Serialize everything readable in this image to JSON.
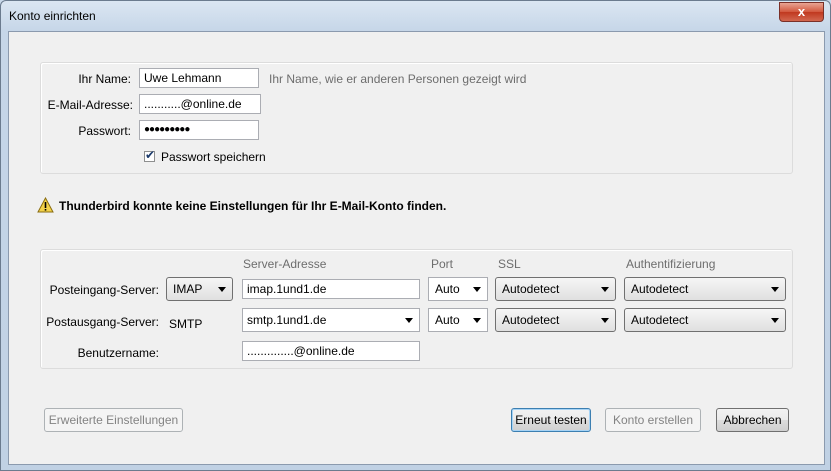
{
  "window": {
    "title": "Konto einrichten",
    "close_label": "x"
  },
  "identity": {
    "name_label": "Ihr Name:",
    "name_value": "Uwe Lehmann",
    "name_hint": "Ihr Name, wie er anderen Personen gezeigt wird",
    "email_label": "E-Mail-Adresse:",
    "email_value": "...........@online.de",
    "password_label": "Passwort:",
    "password_value": "●●●●●●●●●",
    "remember_label": "Passwort speichern",
    "remember_checked": true
  },
  "warning": {
    "icon": "warning-triangle-icon",
    "text": "Thunderbird konnte keine Einstellungen für Ihr E-Mail-Konto finden."
  },
  "server": {
    "headers": {
      "address": "Server-Adresse",
      "port": "Port",
      "ssl": "SSL",
      "auth": "Authentifizierung"
    },
    "incoming": {
      "label": "Posteingang-Server:",
      "protocol": "IMAP",
      "address": "imap.1und1.de",
      "port": "Auto",
      "ssl": "Autodetect",
      "auth": "Autodetect"
    },
    "outgoing": {
      "label": "Postausgang-Server:",
      "protocol": "SMTP",
      "address": "smtp.1und1.de",
      "port": "Auto",
      "ssl": "Autodetect",
      "auth": "Autodetect"
    },
    "username": {
      "label": "Benutzername:",
      "value": "..............@online.de"
    }
  },
  "buttons": {
    "advanced": "Erweiterte Einstellungen",
    "retest": "Erneut testen",
    "create": "Konto erstellen",
    "cancel": "Abbrechen"
  }
}
